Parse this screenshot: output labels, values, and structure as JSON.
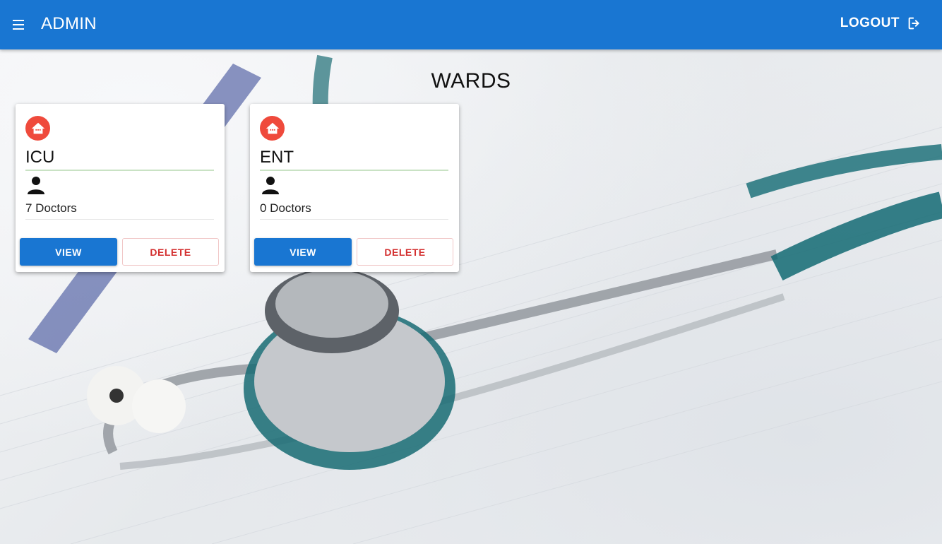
{
  "appbar": {
    "title": "ADMIN",
    "logout_label": "LOGOUT",
    "menu_icon": "hamburger-menu-icon",
    "logout_icon": "logout-icon",
    "color": "#1976d2"
  },
  "page": {
    "title": "WARDS"
  },
  "wards": [
    {
      "name": "ICU",
      "doctors": "7 Doctors",
      "view_label": "VIEW",
      "delete_label": "DELETE",
      "icon": "home-icon"
    },
    {
      "name": "ENT",
      "doctors": "0 Doctors",
      "view_label": "VIEW",
      "delete_label": "DELETE",
      "icon": "home-icon"
    }
  ],
  "colors": {
    "primary": "#1976d2",
    "danger": "#d32f2f",
    "ward_icon": "#ef4a3c",
    "divider_accent": "#c9e2c4"
  }
}
